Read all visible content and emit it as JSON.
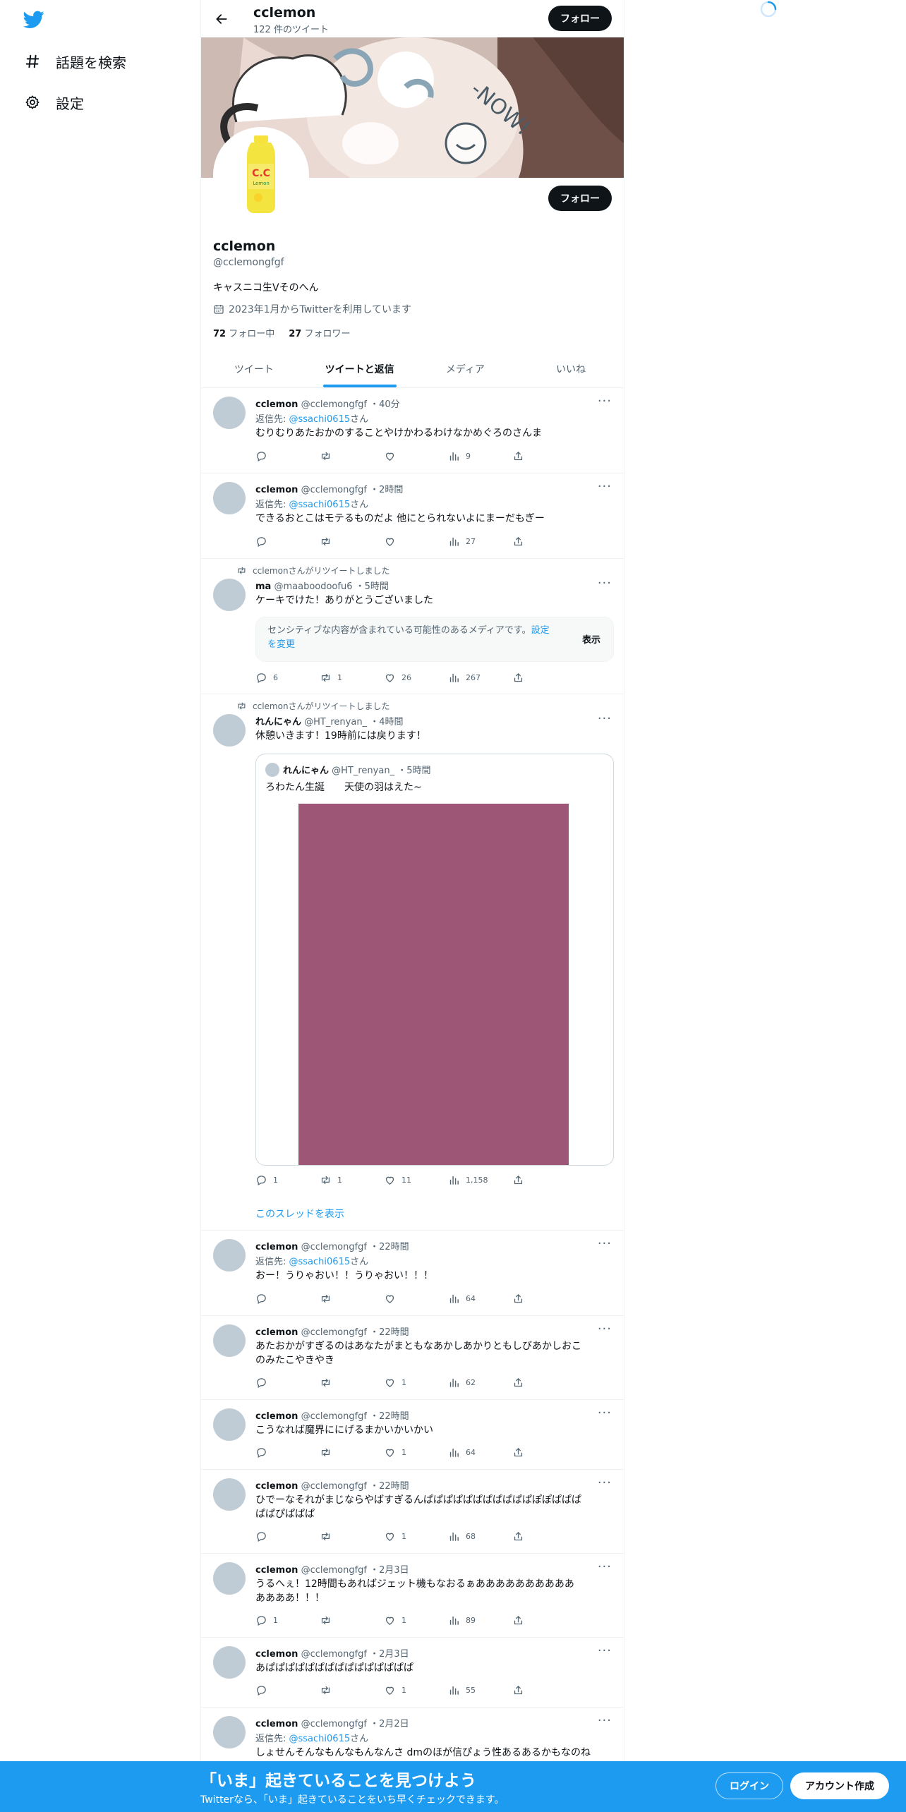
{
  "nav": {
    "explore_label": "話題を検索",
    "settings_label": "設定"
  },
  "header": {
    "name": "cclemon",
    "tweet_count": "122 件のツイート",
    "follow_label": "フォロー"
  },
  "profile": {
    "name": "cclemon",
    "handle": "@cclemongfgf",
    "bio": "キャスニコ生Vそのへん",
    "joined": "2023年1月からTwitterを利用しています",
    "following_count": "72",
    "following_label": "フォロー中",
    "followers_count": "27",
    "followers_label": "フォロワー",
    "follow_label": "フォロー",
    "banner_text": "-NOW!"
  },
  "tabs": [
    "ツイート",
    "ツイートと返信",
    "メディア",
    "いいね"
  ],
  "tweets": [
    {
      "name": "cclemon",
      "handle": "@cclemongfgf",
      "time": "・40分",
      "reply_prefix": "返信先: ",
      "reply_to": "@ssachi0615",
      "reply_suffix": "さん",
      "text": "むりむりあたおかのすることやけかわるわけなかめぐろのさんま",
      "views": "9"
    },
    {
      "name": "cclemon",
      "handle": "@cclemongfgf",
      "time": "・2時間",
      "reply_prefix": "返信先: ",
      "reply_to": "@ssachi0615",
      "reply_suffix": "さん",
      "text": "できるおとこはモテるものだよ 他にとられないよにまーだもぎー",
      "views": "27"
    },
    {
      "rt_label": "cclemonさんがリツイートしました",
      "name": "ma",
      "handle": "@maaboodoofu6",
      "time": "・5時間",
      "text": "ケーキでけた！ありがとうございました",
      "sensitive_text": "センシティブな内容が含まれている可能性のあるメディアです。",
      "sensitive_link": "設定を変更",
      "sensitive_show": "表示",
      "replies": "6",
      "retweets": "1",
      "likes": "26",
      "views": "267"
    },
    {
      "rt_label": "cclemonさんがリツイートしました",
      "name": "れんにゃん",
      "handle": "@HT_renyan_",
      "time": "・4時間",
      "text": "休憩いきます！19時前には戻ります！",
      "quote_name": "れんにゃん",
      "quote_handle": "@HT_renyan_",
      "quote_time": "・5時間",
      "quote_text": "ろわたん生誕　　天使の羽はえた~",
      "replies": "1",
      "retweets": "1",
      "likes": "11",
      "views": "1,158",
      "thread_link": "このスレッドを表示"
    },
    {
      "name": "cclemon",
      "handle": "@cclemongfgf",
      "time": "・22時間",
      "reply_prefix": "返信先: ",
      "reply_to": "@ssachi0615",
      "reply_suffix": "さん",
      "text": "おー！うりゃおい！！うりゃおい！！！",
      "views": "64"
    },
    {
      "name": "cclemon",
      "handle": "@cclemongfgf",
      "time": "・22時間",
      "text_line1": "あたおかがすぎるのはあなたがまともなあかしあかりともしびあかしおこ",
      "text_line2": "のみたこやきやき",
      "likes": "1",
      "views": "62"
    },
    {
      "name": "cclemon",
      "handle": "@cclemongfgf",
      "time": "・22時間",
      "text": "こうなれば魔界ににげるまかいかいかい",
      "likes": "1",
      "views": "64"
    },
    {
      "name": "cclemon",
      "handle": "@cclemongfgf",
      "time": "・22時間",
      "text_line1": "ひでーなそれがまじならやばすぎるんぱぱぱぱぱぱぱぱぱぱぱぽぽぱぱぱ",
      "text_line2": "ぱぱぴぱぱぱ",
      "likes": "1",
      "views": "68"
    },
    {
      "name": "cclemon",
      "handle": "@cclemongfgf",
      "time": "・2月3日",
      "text_line1": "うるへぇ！12時間もあればジェット機もなおるぁああああああああああ",
      "text_line2": "ああああ！！！",
      "replies": "1",
      "likes": "1",
      "views": "89"
    },
    {
      "name": "cclemon",
      "handle": "@cclemongfgf",
      "time": "・2月3日",
      "text": "あぱぱぱぱぱぱぱぱぱぱぱぱぱぱぱ",
      "likes": "1",
      "views": "55"
    },
    {
      "name": "cclemon",
      "handle": "@cclemongfgf",
      "time": "・2月2日",
      "reply_prefix": "返信先: ",
      "reply_to": "@ssachi0615",
      "reply_suffix": "さん",
      "text": "しょせんそんなもんなもんなんさ dmのほが信ぴょう性あるあるかもなのね"
    }
  ],
  "bottombar": {
    "title": "「いま」起きていることを見つけよう",
    "subtitle": "Twitterなら、「いま」起きていることをいち早くチェックできます。",
    "login": "ログイン",
    "signup": "アカウント作成"
  },
  "colors": {
    "accent": "#1d9bf0",
    "bottom_bar": "#1d9bf0",
    "avatar_placeholder": "#c0ccd5",
    "quote_image": "#9d5676"
  }
}
